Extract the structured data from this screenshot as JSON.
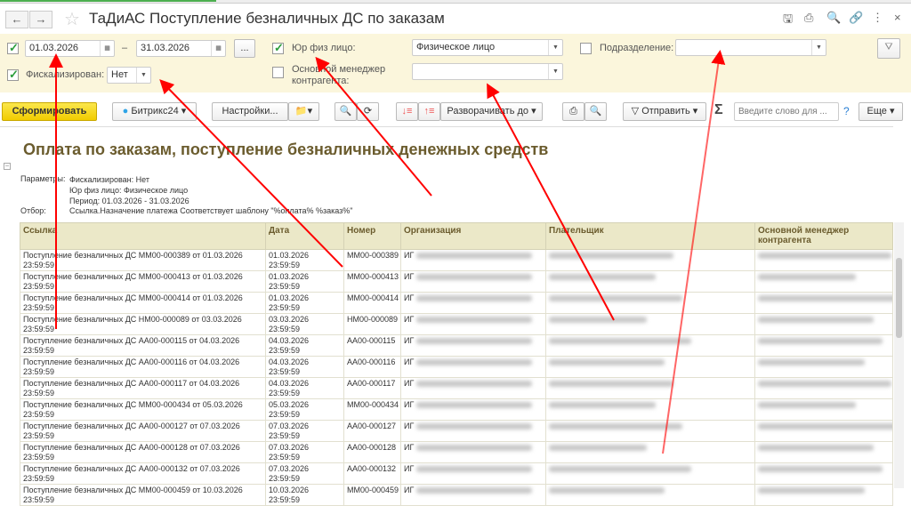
{
  "window": {
    "title": "ТаДиАС Поступление безналичных ДС по заказам",
    "back": "←",
    "forward": "→"
  },
  "filters": {
    "period_enabled": true,
    "date_from": "01.03.2026",
    "date_sep": "–",
    "date_to": "31.03.2026",
    "period_button": "...",
    "fiscal_enabled": true,
    "fiscal_label": "Фискализирован:",
    "fiscal_value": "Нет",
    "legal_enabled": true,
    "legal_label": "Юр физ лицо:",
    "legal_value": "Физическое лицо",
    "manager_enabled": false,
    "manager_label": "Основной менеджер контрагента:",
    "manager_value": "",
    "division_enabled": false,
    "division_label": "Подразделение:",
    "division_value": ""
  },
  "toolbar": {
    "generate": "Сформировать",
    "bitrix": "Битрикс24",
    "settings": "Настройки...",
    "expand": "Разворачивать до",
    "send": "Отправить",
    "sigma": "Σ",
    "search_placeholder": "Введите слово для ...",
    "help": "?",
    "more": "Еще"
  },
  "report": {
    "title": "Оплата по заказам, поступление безналичных денежных средств",
    "params_label": "Параметры:",
    "params": [
      "Фискализирован: Нет",
      "Юр физ лицо: Физическое лицо",
      "Период: 01.03.2026 - 31.03.2026"
    ],
    "filter_label": "Отбор:",
    "filter": "Ссылка.Назначение платежа Соответствует шаблону \"%оплата% %заказ%\"",
    "columns": [
      "Ссылка",
      "Дата",
      "Номер",
      "Организация",
      "Плательщик",
      "Основной менеджер контрагента"
    ],
    "rows": [
      {
        "link": "Поступление безналичных ДС ММ00-000389 от 01.03.2026 23:59:59",
        "date": "01.03.2026 23:59:59",
        "number": "ММ00-000389",
        "org": "ИГ"
      },
      {
        "link": "Поступление безналичных ДС ММ00-000413 от 01.03.2026 23:59:59",
        "date": "01.03.2026 23:59:59",
        "number": "ММ00-000413",
        "org": "ИГ"
      },
      {
        "link": "Поступление безналичных ДС ММ00-000414 от 01.03.2026 23:59:59",
        "date": "01.03.2026 23:59:59",
        "number": "ММ00-000414",
        "org": "ИГ"
      },
      {
        "link": "Поступление безналичных ДС НМ00-000089 от 03.03.2026 23:59:59",
        "date": "03.03.2026 23:59:59",
        "number": "НМ00-000089",
        "org": "ИГ"
      },
      {
        "link": "Поступление безналичных ДС АА00-000115 от 04.03.2026 23:59:59",
        "date": "04.03.2026 23:59:59",
        "number": "АА00-000115",
        "org": "ИГ"
      },
      {
        "link": "Поступление безналичных ДС АА00-000116 от 04.03.2026 23:59:59",
        "date": "04.03.2026 23:59:59",
        "number": "АА00-000116",
        "org": "ИГ"
      },
      {
        "link": "Поступление безналичных ДС АА00-000117 от 04.03.2026 23:59:59",
        "date": "04.03.2026 23:59:59",
        "number": "АА00-000117",
        "org": "ИГ"
      },
      {
        "link": "Поступление безналичных ДС ММ00-000434 от 05.03.2026 23:59:59",
        "date": "05.03.2026 23:59:59",
        "number": "ММ00-000434",
        "org": "ИГ"
      },
      {
        "link": "Поступление безналичных ДС АА00-000127 от 07.03.2026 23:59:59",
        "date": "07.03.2026 23:59:59",
        "number": "АА00-000127",
        "org": "ИГ"
      },
      {
        "link": "Поступление безналичных ДС АА00-000128 от 07.03.2026 23:59:59",
        "date": "07.03.2026 23:59:59",
        "number": "АА00-000128",
        "org": "ИГ"
      },
      {
        "link": "Поступление безналичных ДС АА00-000132 от 07.03.2026 23:59:59",
        "date": "07.03.2026 23:59:59",
        "number": "АА00-000132",
        "org": "ИГ"
      },
      {
        "link": "Поступление безналичных ДС ММ00-000459 от 10.03.2026 23:59:59",
        "date": "10.03.2026 23:59:59",
        "number": "ММ00-000459",
        "org": "ИГ"
      }
    ]
  },
  "colors": {
    "accent_button": "#f1cc00",
    "filter_bg": "#fbf6dc",
    "header_bg": "#ebe8c8",
    "title": "#6b5c2e",
    "annotation": "#ff0000"
  }
}
